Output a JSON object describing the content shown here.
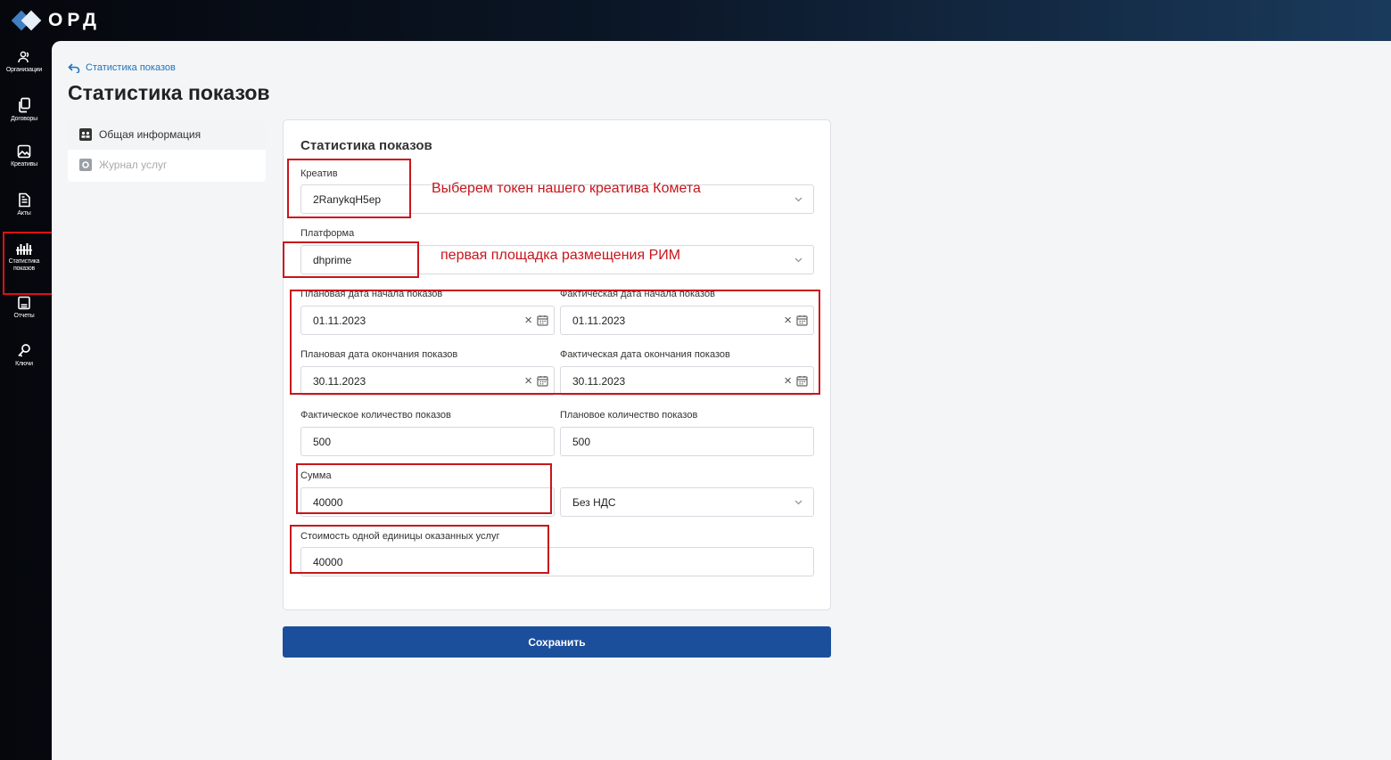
{
  "app": {
    "logo_text": "ОРД"
  },
  "sidebar": {
    "items": [
      {
        "label": "Организации",
        "icon": "users-icon"
      },
      {
        "label": "Договоры",
        "icon": "documents-icon"
      },
      {
        "label": "Креативы",
        "icon": "image-icon"
      },
      {
        "label": "Акты",
        "icon": "file-text-icon"
      },
      {
        "label": "Статистика показов",
        "icon": "stats-icon",
        "active": true
      },
      {
        "label": "Отчеты",
        "icon": "report-icon"
      },
      {
        "label": "Ключи",
        "icon": "key-icon"
      }
    ]
  },
  "breadcrumb": {
    "label": "Статистика показов"
  },
  "page": {
    "title": "Статистика показов"
  },
  "subnav": {
    "items": [
      {
        "label": "Общая информация",
        "state": "active"
      },
      {
        "label": "Журнал услуг",
        "state": "disabled"
      }
    ]
  },
  "form": {
    "title": "Статистика показов",
    "creative": {
      "label": "Креатив",
      "value": "2RanykqH5ep"
    },
    "platform": {
      "label": "Платформа",
      "value": "dhprime"
    },
    "planned_start": {
      "label": "Плановая дата начала показов",
      "value": "01.11.2023"
    },
    "actual_start": {
      "label": "Фактическая дата начала показов",
      "value": "01.11.2023"
    },
    "planned_end": {
      "label": "Плановая дата окончания показов",
      "value": "30.11.2023"
    },
    "actual_end": {
      "label": "Фактическая дата окончания показов",
      "value": "30.11.2023"
    },
    "actual_count": {
      "label": "Фактическое количество показов",
      "value": "500"
    },
    "planned_count": {
      "label": "Плановое количество показов",
      "value": "500"
    },
    "amount": {
      "label": "Сумма",
      "value": "40000"
    },
    "vat": {
      "value": "Без НДС"
    },
    "unit_cost": {
      "label": "Стоимость одной единицы оказанных услуг",
      "value": "40000"
    },
    "save_label": "Сохранить"
  },
  "annotations": {
    "creative_note": "Выберем токен нашего креатива Комета",
    "platform_note": "первая площадка размещения РИМ",
    "color": "#c8151b"
  },
  "colors": {
    "accent": "#1b4f9c",
    "link": "#1e73be"
  }
}
